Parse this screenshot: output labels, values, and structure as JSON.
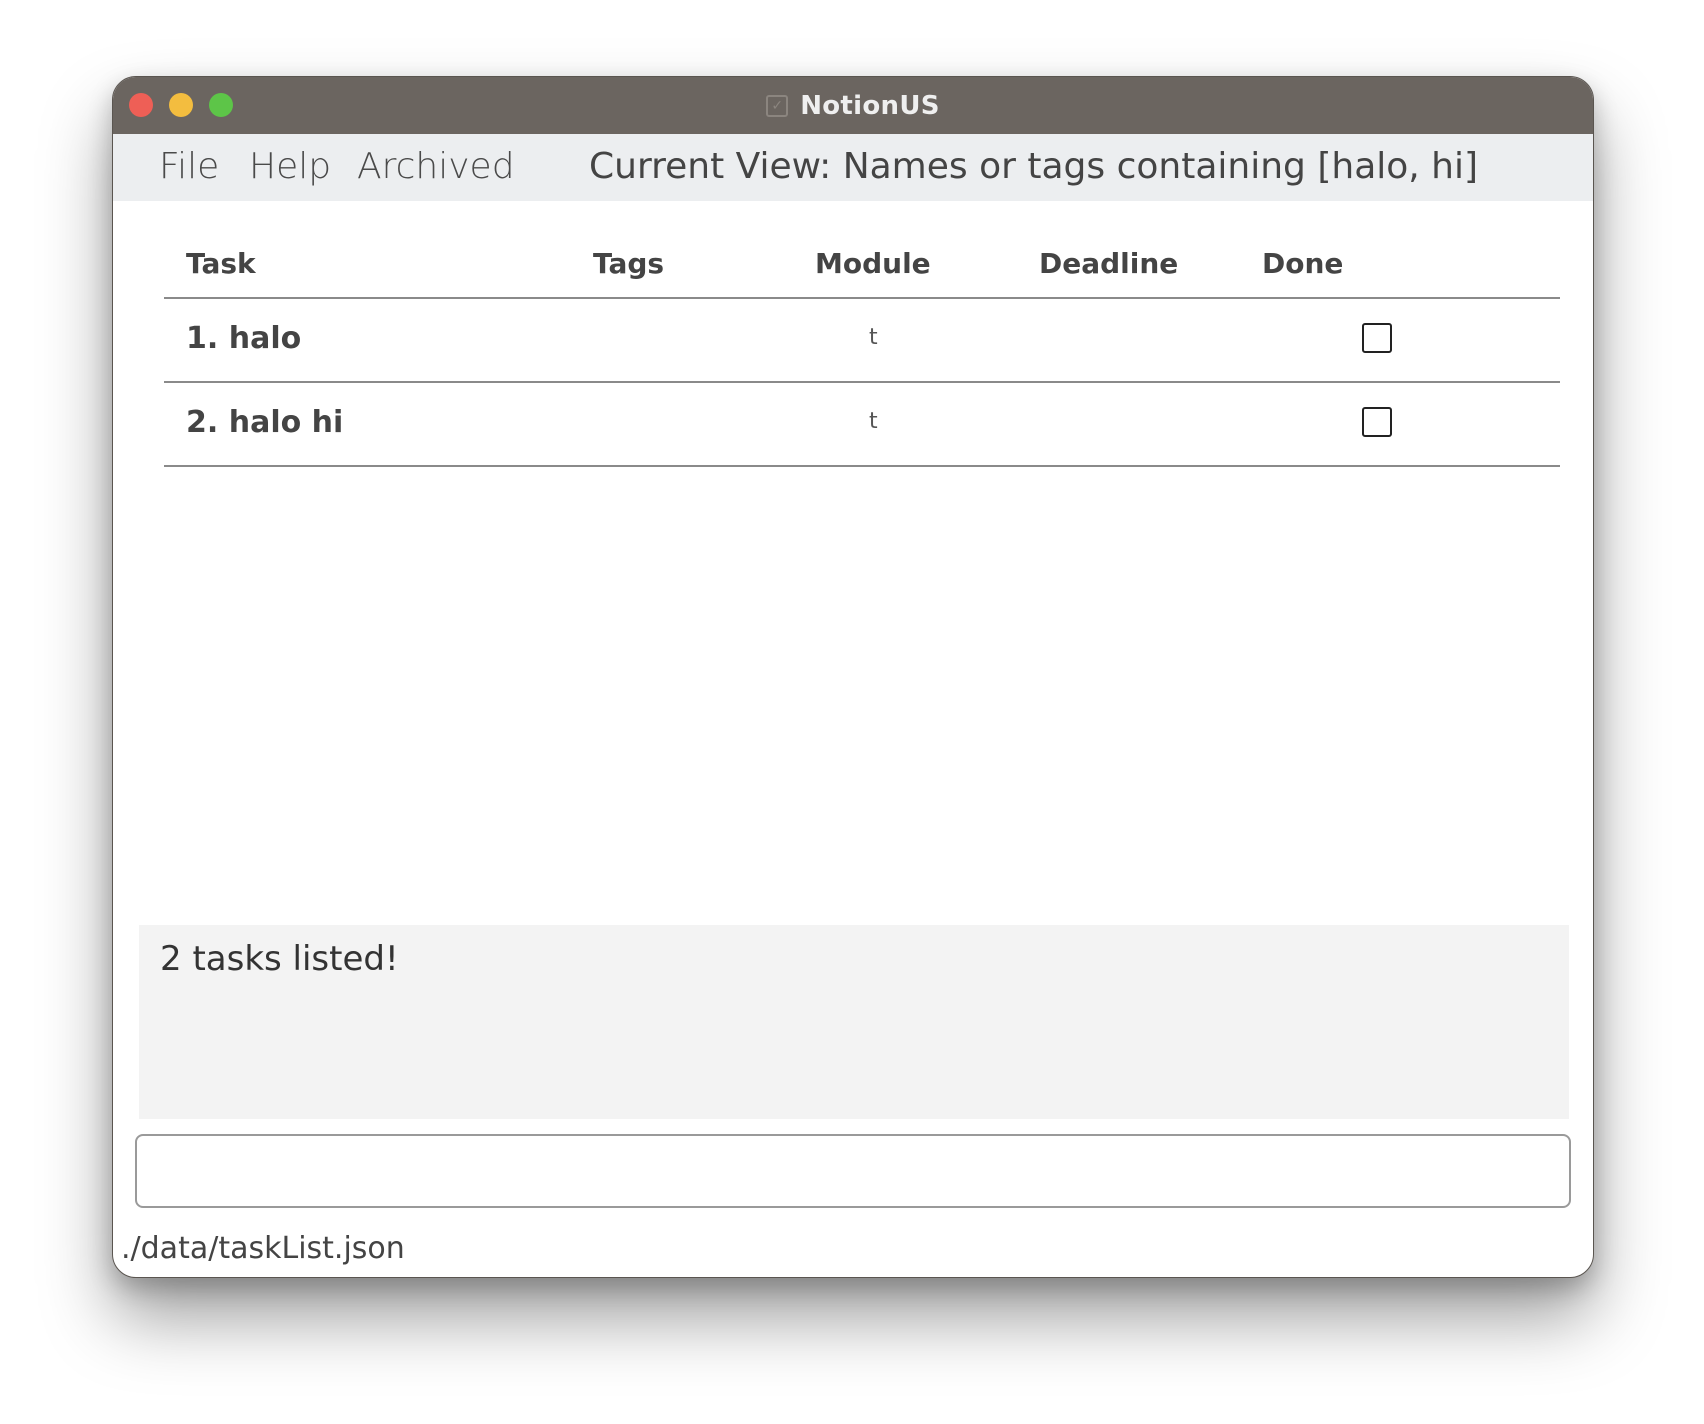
{
  "window": {
    "title": "NotionUS",
    "app_icon": "checkmark-box-icon"
  },
  "menubar": {
    "items": [
      {
        "label": "File"
      },
      {
        "label": "Help"
      },
      {
        "label": "Archived"
      }
    ],
    "current_view": "Current View: Names or tags containing [halo, hi]"
  },
  "table": {
    "columns": [
      "Task",
      "Tags",
      "Module",
      "Deadline",
      "Done"
    ],
    "rows": [
      {
        "name": "1. halo",
        "tags": "",
        "module": "t",
        "deadline": "",
        "done": false
      },
      {
        "name": "2. halo hi",
        "tags": "",
        "module": "t",
        "deadline": "",
        "done": false
      }
    ]
  },
  "result": {
    "message": "2 tasks listed!"
  },
  "command": {
    "value": "",
    "placeholder": ""
  },
  "status": {
    "path": "./data/taskList.json"
  },
  "colors": {
    "titlebar": "#6b6560",
    "menubar": "#eceef0",
    "close": "#ee5f56",
    "minimize": "#f3bd3f",
    "maximize": "#5dc548"
  }
}
